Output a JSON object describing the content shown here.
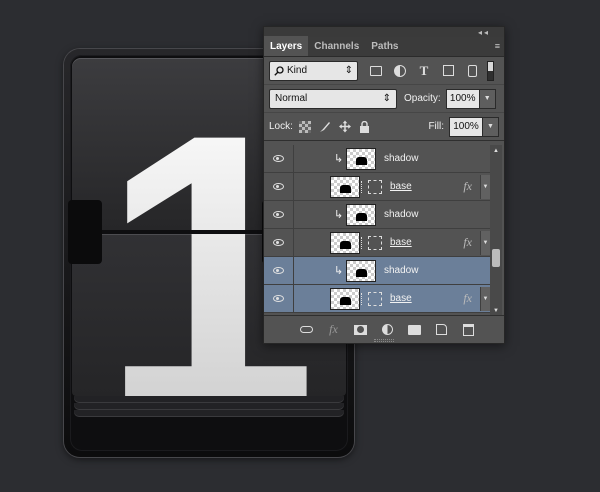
{
  "artwork": {
    "digit": "1"
  },
  "panel": {
    "collapse_glyph": "◂◂",
    "tabs": [
      {
        "label": "Layers",
        "active": true
      },
      {
        "label": "Channels",
        "active": false
      },
      {
        "label": "Paths",
        "active": false
      }
    ],
    "menu_glyph": "≡"
  },
  "filter": {
    "icon": "search-icon",
    "label": "Kind",
    "arrow": "⇕"
  },
  "blend": {
    "mode": "Normal",
    "arrow": "⇕",
    "opacity_label": "Opacity:",
    "opacity_value": "100%",
    "arrow_down": "▼"
  },
  "lock": {
    "label": "Lock:",
    "fill_label": "Fill:",
    "fill_value": "100%",
    "arrow_down": "▼"
  },
  "layers": [
    {
      "name": "shadow",
      "type": "clipped",
      "selected": false,
      "fx": ""
    },
    {
      "name": "base",
      "type": "masked",
      "selected": false,
      "fx": "fx"
    },
    {
      "name": "shadow",
      "type": "clipped",
      "selected": false,
      "fx": ""
    },
    {
      "name": "base",
      "type": "masked",
      "selected": false,
      "fx": "fx"
    },
    {
      "name": "shadow",
      "type": "clipped",
      "selected": true,
      "fx": ""
    },
    {
      "name": "base",
      "type": "masked",
      "selected": true,
      "fx": "fx"
    }
  ],
  "glyphs": {
    "clip_arrow": "↳",
    "expand": "▼",
    "scroll_up": "▲",
    "scroll_down": "▼"
  },
  "colors": {
    "selection": "#6b7f99",
    "panel": "#535353",
    "background": "#2c2d31"
  }
}
